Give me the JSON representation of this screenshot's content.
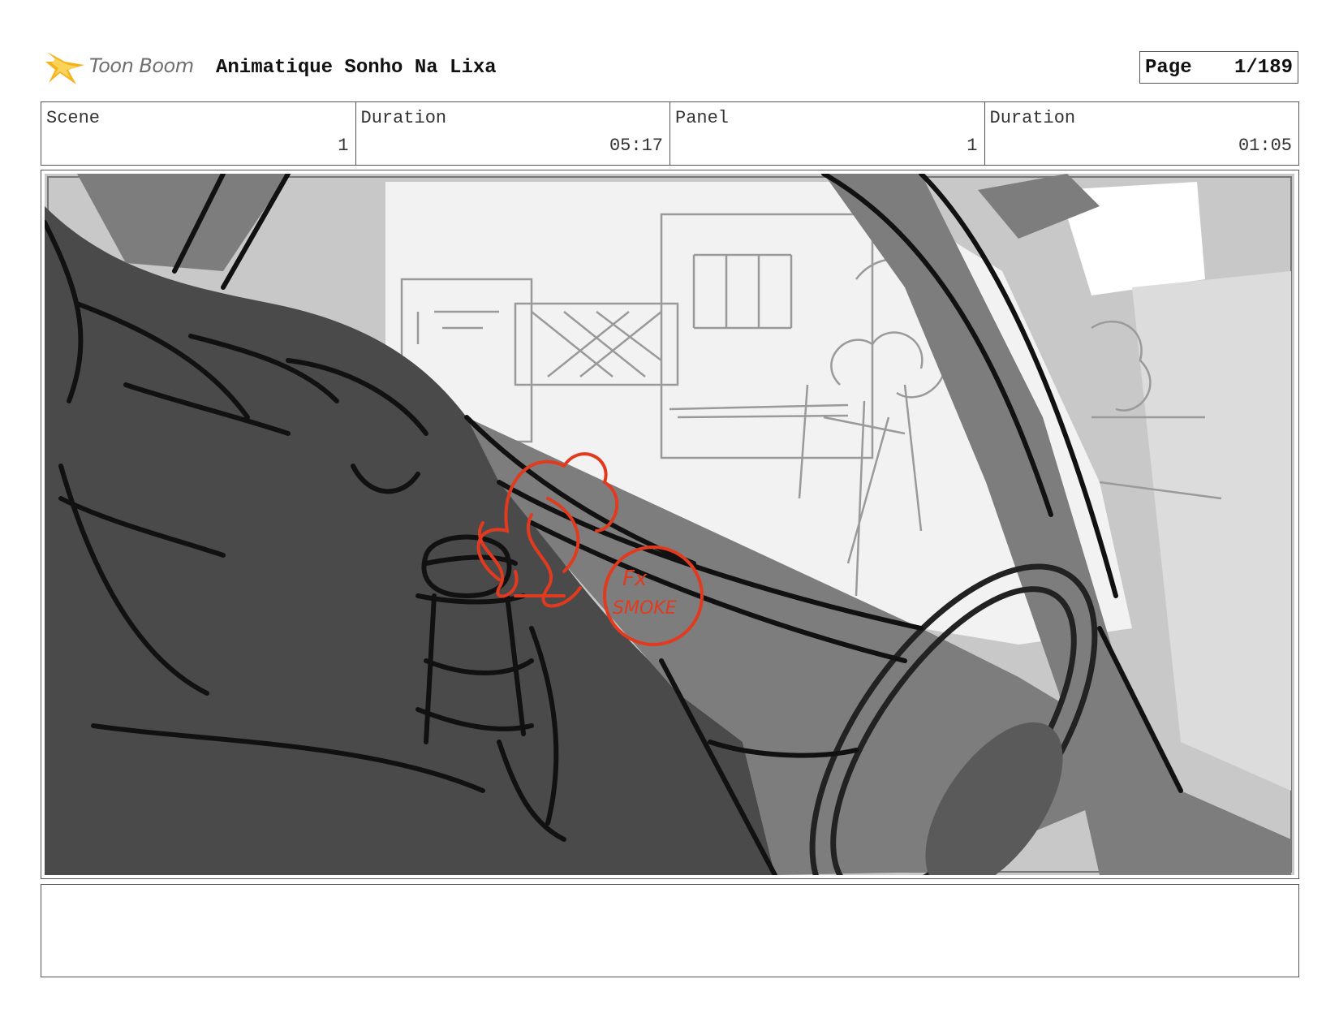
{
  "header": {
    "logo_text": "Toon Boom",
    "title": "Animatique Sonho Na Lixa",
    "page_label": "Page",
    "page_value": "1/189"
  },
  "info": {
    "scene_label": "Scene",
    "scene_value": "1",
    "scene_duration_label": "Duration",
    "scene_duration_value": "05:17",
    "panel_label": "Panel",
    "panel_value": "1",
    "panel_duration_label": "Duration",
    "panel_duration_value": "01:05"
  },
  "panel": {
    "annotation_line1": "Fx",
    "annotation_line2": "SMOKE"
  },
  "colors": {
    "accent": "#f5b21a",
    "annotation_red": "#e23a1e",
    "dark_fill": "#4a4a4a",
    "mid_fill": "#7d7d7d",
    "light_fill": "#c8c8c8"
  },
  "notes": {
    "text": ""
  }
}
